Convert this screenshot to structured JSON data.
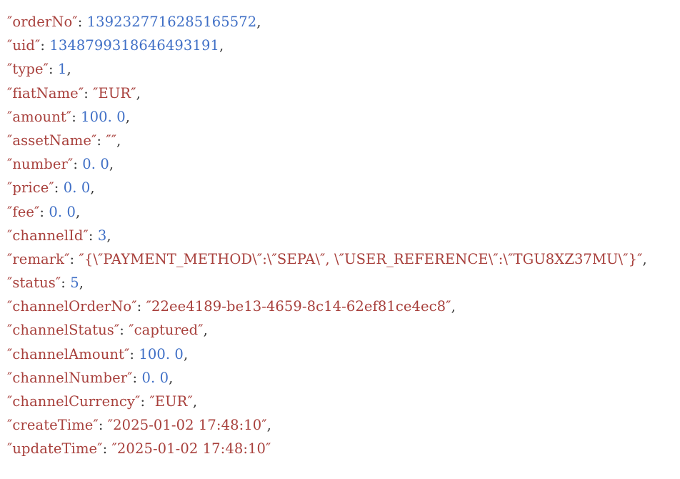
{
  "view": {
    "kind": "json-code-snippet",
    "background_color": "#ffffff",
    "key_color": "#a8403c",
    "string_color": "#a8403c",
    "number_color": "#3f6fc6",
    "punctuation_color": "#3a3a3a",
    "quote_glyph": "″",
    "line_count": 19
  },
  "json": {
    "lines": [
      {
        "index": 0,
        "key": "orderNo",
        "value": "1392327716285165572",
        "value_type": "number",
        "trailing_comma": true,
        "text": "″orderNo″: 1392327716285165572,"
      },
      {
        "index": 1,
        "key": "uid",
        "value": "1348799318646493191",
        "value_type": "number",
        "trailing_comma": true,
        "text": "″uid″: 1348799318646493191,"
      },
      {
        "index": 2,
        "key": "type",
        "value": "1",
        "value_type": "number",
        "trailing_comma": true,
        "text": "″type″: 1,"
      },
      {
        "index": 3,
        "key": "fiatName",
        "value": "EUR",
        "value_type": "string",
        "trailing_comma": true,
        "text": "″fiatName″: ″EUR″,"
      },
      {
        "index": 4,
        "key": "amount",
        "value": "100. 0",
        "value_type": "number",
        "trailing_comma": true,
        "text": "″amount″: 100. 0,"
      },
      {
        "index": 5,
        "key": "assetName",
        "value": "",
        "value_type": "string",
        "trailing_comma": true,
        "text": "″assetName″: ″″,"
      },
      {
        "index": 6,
        "key": "number",
        "value": "0. 0",
        "value_type": "number",
        "trailing_comma": true,
        "text": "″number″: 0. 0,"
      },
      {
        "index": 7,
        "key": "price",
        "value": "0. 0",
        "value_type": "number",
        "trailing_comma": true,
        "text": "″price″: 0. 0,"
      },
      {
        "index": 8,
        "key": "fee",
        "value": "0. 0",
        "value_type": "number",
        "trailing_comma": true,
        "text": "″fee″: 0. 0,"
      },
      {
        "index": 9,
        "key": "channelId",
        "value": "3",
        "value_type": "number",
        "trailing_comma": true,
        "text": "″channelId″: 3,"
      },
      {
        "index": 10,
        "key": "remark",
        "value": "{\\″PAYMENT_METHOD\\″:\\″SEPA\\″, \\″USER_REFERENCE\\″:\\″TGU8XZ37MU\\″}",
        "value_type": "string",
        "trailing_comma": true,
        "text": "″remark″: ″{\\″PAYMENT_METHOD\\″:\\″SEPA\\″, \\″USER_REFERENCE\\″:\\″TGU8XZ37MU\\″}″,"
      },
      {
        "index": 11,
        "key": "status",
        "value": "5",
        "value_type": "number",
        "trailing_comma": true,
        "text": "″status″: 5,"
      },
      {
        "index": 12,
        "key": "channelOrderNo",
        "value": "22ee4189-be13-4659-8c14-62ef81ce4ec8",
        "value_type": "string",
        "trailing_comma": true,
        "text": "″channelOrderNo″: ″22ee4189-be13-4659-8c14-62ef81ce4ec8″,"
      },
      {
        "index": 13,
        "key": "channelStatus",
        "value": "captured",
        "value_type": "string",
        "trailing_comma": true,
        "text": "″channelStatus″: ″captured″,"
      },
      {
        "index": 14,
        "key": "channelAmount",
        "value": "100. 0",
        "value_type": "number",
        "trailing_comma": true,
        "text": "″channelAmount″: 100. 0,"
      },
      {
        "index": 15,
        "key": "channelNumber",
        "value": "0. 0",
        "value_type": "number",
        "trailing_comma": true,
        "text": "″channelNumber″: 0. 0,"
      },
      {
        "index": 16,
        "key": "channelCurrency",
        "value": "EUR",
        "value_type": "string",
        "trailing_comma": true,
        "text": "″channelCurrency″: ″EUR″,"
      },
      {
        "index": 17,
        "key": "createTime",
        "value": "2025-01-02 17:48:10",
        "value_type": "string",
        "trailing_comma": true,
        "text": "″createTime″: ″2025-01-02 17:48:10″,"
      },
      {
        "index": 18,
        "key": "updateTime",
        "value": "2025-01-02 17:48:10",
        "value_type": "string",
        "trailing_comma": false,
        "text": "″updateTime″: ″2025-01-02 17:48:10″"
      }
    ]
  }
}
